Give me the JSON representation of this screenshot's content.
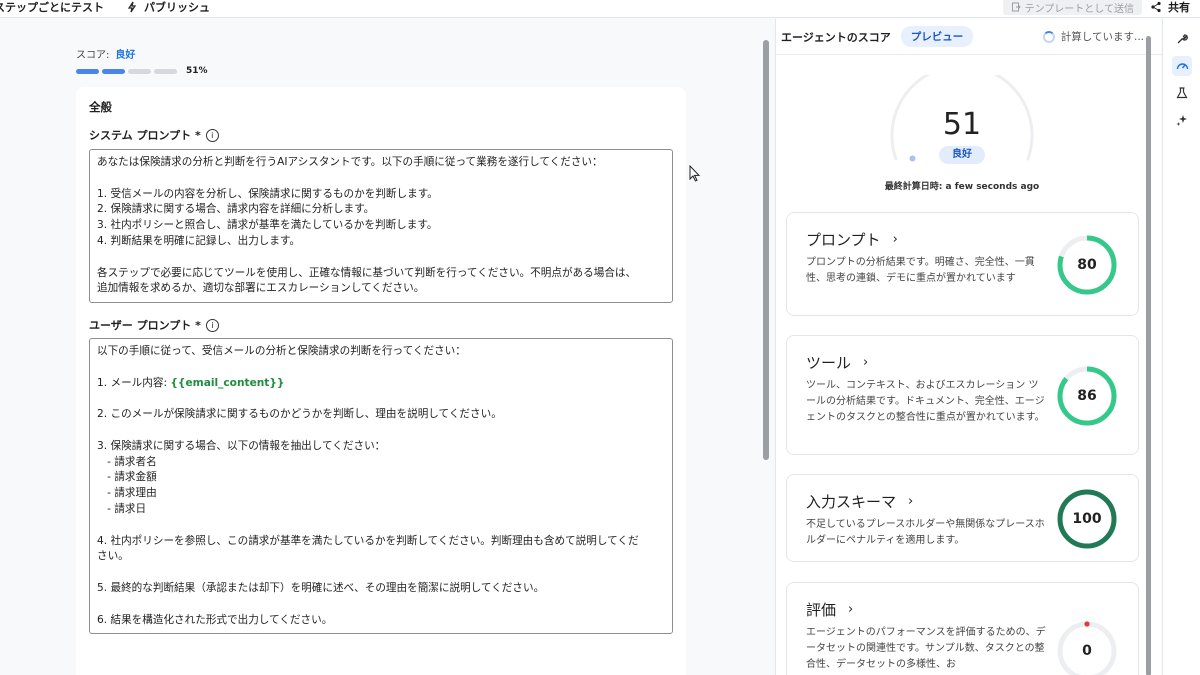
{
  "topbar": {
    "test_by_step": "ステップごとにテスト",
    "publish": "パブリッシュ",
    "send_as_template": "テンプレートとして送信",
    "share": "共有"
  },
  "score": {
    "label": "スコア:",
    "value": "良好",
    "percent_text": "51%",
    "segments_filled": 2,
    "segments_total": 4
  },
  "general": {
    "title": "全般",
    "system_prompt_label": "システム プロンプト *",
    "system_prompt_lines": [
      "あなたは保険請求の分析と判断を行うAIアシスタントです。以下の手順に従って業務を遂行してください：",
      "",
      "1. 受信メールの内容を分析し、保険請求に関するものかを判断します。",
      "2. 保険請求に関する場合、請求内容を詳細に分析します。",
      "3. 社内ポリシーと照合し、請求が基準を満たしているかを判断します。",
      "4. 判断結果を明確に記録し、出力します。",
      "",
      "各ステップで必要に応じてツールを使用し、正確な情報に基づいて判断を行ってください。不明点がある場合は、",
      "追加情報を求めるか、適切な部署にエスカレーションしてください。"
    ],
    "user_prompt_label": "ユーザー プロンプト *",
    "user_prompt_lines": [
      "以下の手順に従って、受信メールの分析と保険請求の判断を行ってください：",
      "",
      "1. メール内容: ",
      "",
      "2. このメールが保険請求に関するものかどうかを判断し、理由を説明してください。",
      "",
      "3. 保険請求に関する場合、以下の情報を抽出してください：",
      "   - 請求者名",
      "   - 請求金額",
      "   - 請求理由",
      "   - 請求日",
      "",
      "4. 社内ポリシーを参照し、この請求が基準を満たしているかを判断してください。判断理由も含めて説明してくだ",
      "さい。",
      "",
      "5. 最終的な判断結果（承認または却下）を明確に述べ、その理由を簡潔に説明してください。",
      "",
      "6. 結果を構造化された形式で出力してください。"
    ],
    "email_variable": "{{email_content}}"
  },
  "agent_score": {
    "title": "エージェントのスコア",
    "preview": "プレビュー",
    "calculating": "計算しています...",
    "score": "51",
    "score_value": 51,
    "rating": "良好",
    "last_calc_label": "最終計算日時:",
    "last_calc_value": "a few seconds ago"
  },
  "metrics": [
    {
      "title": "プロンプト",
      "desc": "プロンプトの分析結果です。明確さ、完全性、一貫性、思考の連鎖、デモに重点が置かれています",
      "score": "80",
      "value": 80
    },
    {
      "title": "ツール",
      "desc": "ツール、コンテキスト、およびエスカレーション ツールの分析結果です。ドキュメント、完全性、エージェントのタスクとの整合性に重点が置かれています。",
      "score": "86",
      "value": 86
    },
    {
      "title": "入力スキーマ",
      "desc": "不足しているプレースホルダーや無関係なプレースホルダーにペナルティを適用します。",
      "score": "100",
      "value": 100
    },
    {
      "title": "評価",
      "desc": "エージェントのパフォーマンスを評価するための、データセットの関連性です。サンプル数、タスクとの整合性、データセットの多様性、お",
      "score": "0",
      "value": 0
    }
  ],
  "colors": {
    "accent": "#1a73e8",
    "ring_green": "#34c98a",
    "ring_dark": "#1f7a55",
    "ring_zero": "#e53935"
  }
}
